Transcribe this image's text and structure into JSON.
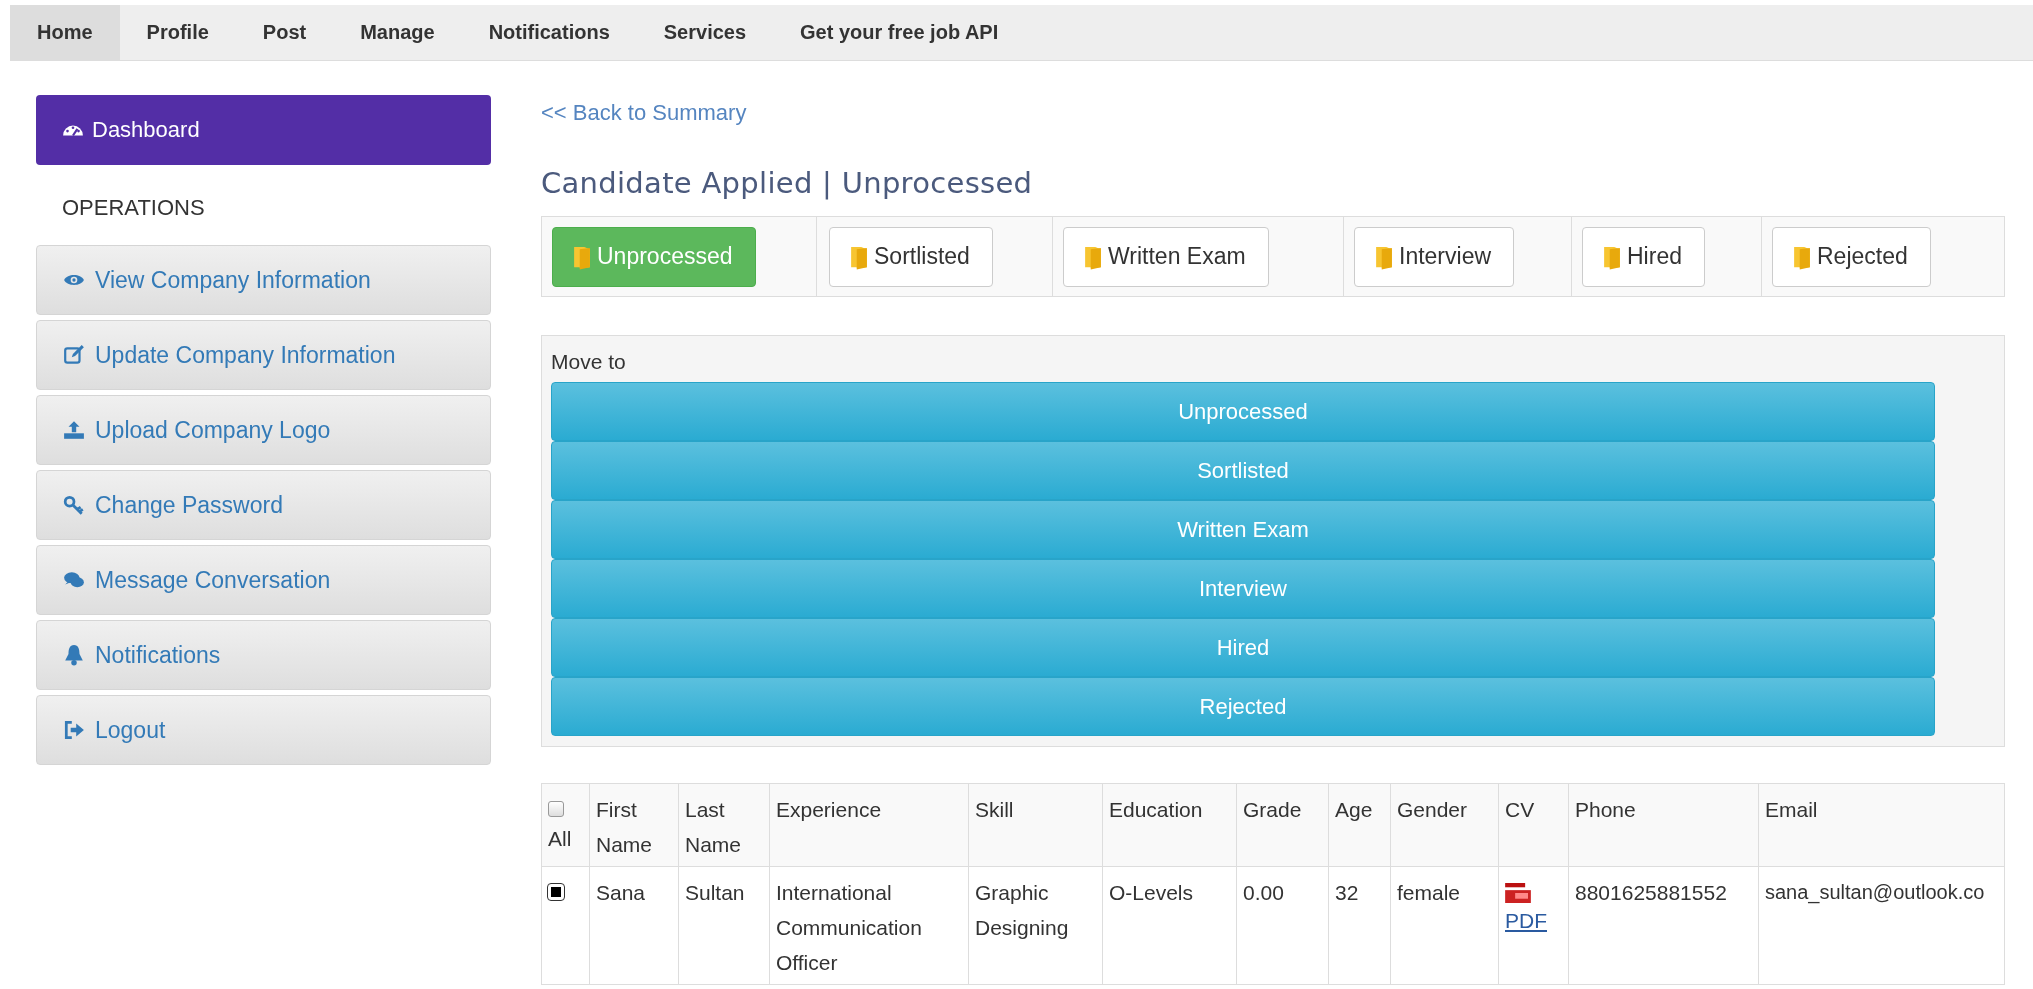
{
  "nav": [
    {
      "label": "Home",
      "selected": true
    },
    {
      "label": "Profile",
      "selected": false
    },
    {
      "label": "Post",
      "selected": false
    },
    {
      "label": "Manage",
      "selected": false
    },
    {
      "label": "Notifications",
      "selected": false
    },
    {
      "label": "Services",
      "selected": false
    },
    {
      "label": "Get your free job API",
      "selected": false
    }
  ],
  "sidebar": {
    "dashboard": {
      "label": "Dashboard",
      "selected": true
    },
    "heading": "OPERATIONS",
    "items": [
      {
        "label": "View Company Information"
      },
      {
        "label": "Update Company Information"
      },
      {
        "label": "Upload Company Logo"
      },
      {
        "label": "Change Password"
      },
      {
        "label": "Message Conversation"
      },
      {
        "label": "Notifications"
      },
      {
        "label": "Logout"
      }
    ]
  },
  "back_link": "<< Back to Summary",
  "title": "Candidate Applied | Unprocessed",
  "status_tabs": [
    {
      "label": "Unprocessed",
      "selected": true
    },
    {
      "label": "Sortlisted",
      "selected": false
    },
    {
      "label": "Written Exam",
      "selected": false
    },
    {
      "label": "Interview",
      "selected": false
    },
    {
      "label": "Hired",
      "selected": false
    },
    {
      "label": "Rejected",
      "selected": false
    }
  ],
  "move_to": {
    "label": "Move to",
    "buttons": [
      "Unprocessed",
      "Sortlisted",
      "Written Exam",
      "Interview",
      "Hired",
      "Rejected"
    ]
  },
  "table": {
    "select_all": {
      "label": "All",
      "checked": false
    },
    "columns": [
      "First Name",
      "Last Name",
      "Experience",
      "Skill",
      "Education",
      "Grade",
      "Age",
      "Gender",
      "CV",
      "Phone",
      "Email"
    ],
    "rows": [
      {
        "checked": true,
        "first_name": "Sana",
        "last_name": "Sultan",
        "experience": "International Communication Officer",
        "skill": "Graphic Designing",
        "education": "O-Levels",
        "grade": "0.00",
        "age": "32",
        "gender": "female",
        "cv": "PDF",
        "phone": "8801625881552",
        "email": "sana_sultan@outlook.co"
      }
    ]
  }
}
